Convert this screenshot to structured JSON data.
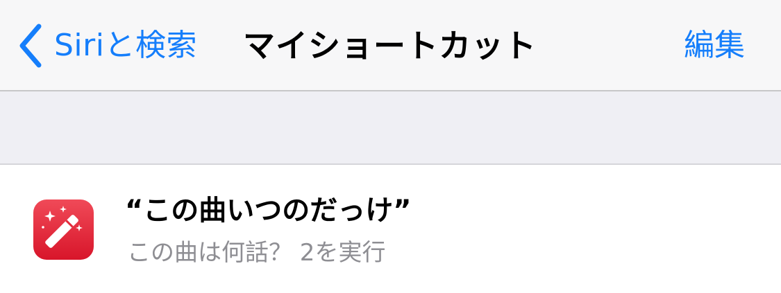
{
  "navbar": {
    "back_label": "Siriと検索",
    "title": "マイショートカット",
    "edit_label": "編集"
  },
  "shortcut": {
    "title": "“この曲いつのだっけ”",
    "subtitle": "この曲は何話？ 2を実行",
    "icon": "magic-wand-icon",
    "icon_color": "#e32a3b"
  },
  "colors": {
    "accent": "#157efb",
    "navbar_bg": "#f7f7f8",
    "group_bg": "#efeff4",
    "secondary_text": "#8e8e93"
  }
}
